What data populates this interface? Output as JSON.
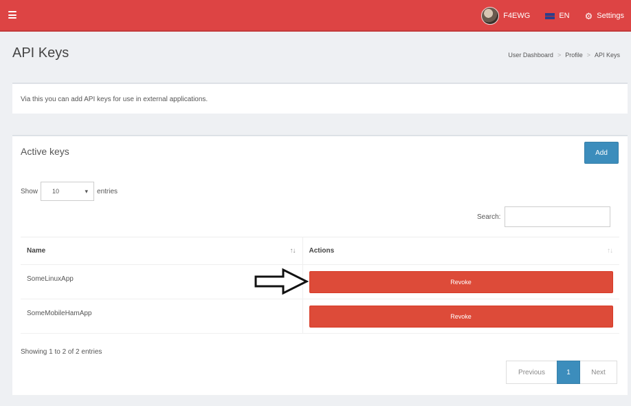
{
  "topbar": {
    "username": "F4EWG",
    "language": "EN",
    "settings_label": "Settings",
    "icons": [
      "menu-icon",
      "avatar",
      "flag-icon",
      "gear-icon"
    ],
    "accent_color": "#dd4444"
  },
  "header": {
    "title": "API Keys",
    "breadcrumb": [
      "User Dashboard",
      "Profile",
      "API Keys"
    ],
    "breadcrumb_separator": ">"
  },
  "info": {
    "text": "Via this you can add API keys for use in external applications."
  },
  "keys_panel": {
    "title": "Active keys",
    "add_label": "Add",
    "show_label": "Show",
    "entries_value": "10",
    "entries_label": "entries",
    "search_label": "Search:",
    "search_value": "",
    "columns": [
      "Name",
      "Actions"
    ],
    "rows": [
      {
        "name": "SomeLinuxApp",
        "action": "Revoke"
      },
      {
        "name": "SomeMobileHamApp",
        "action": "Revoke"
      }
    ],
    "summary": "Showing 1 to 2 of 2 entries",
    "pagination": {
      "previous": "Previous",
      "current": "1",
      "next": "Next"
    }
  }
}
